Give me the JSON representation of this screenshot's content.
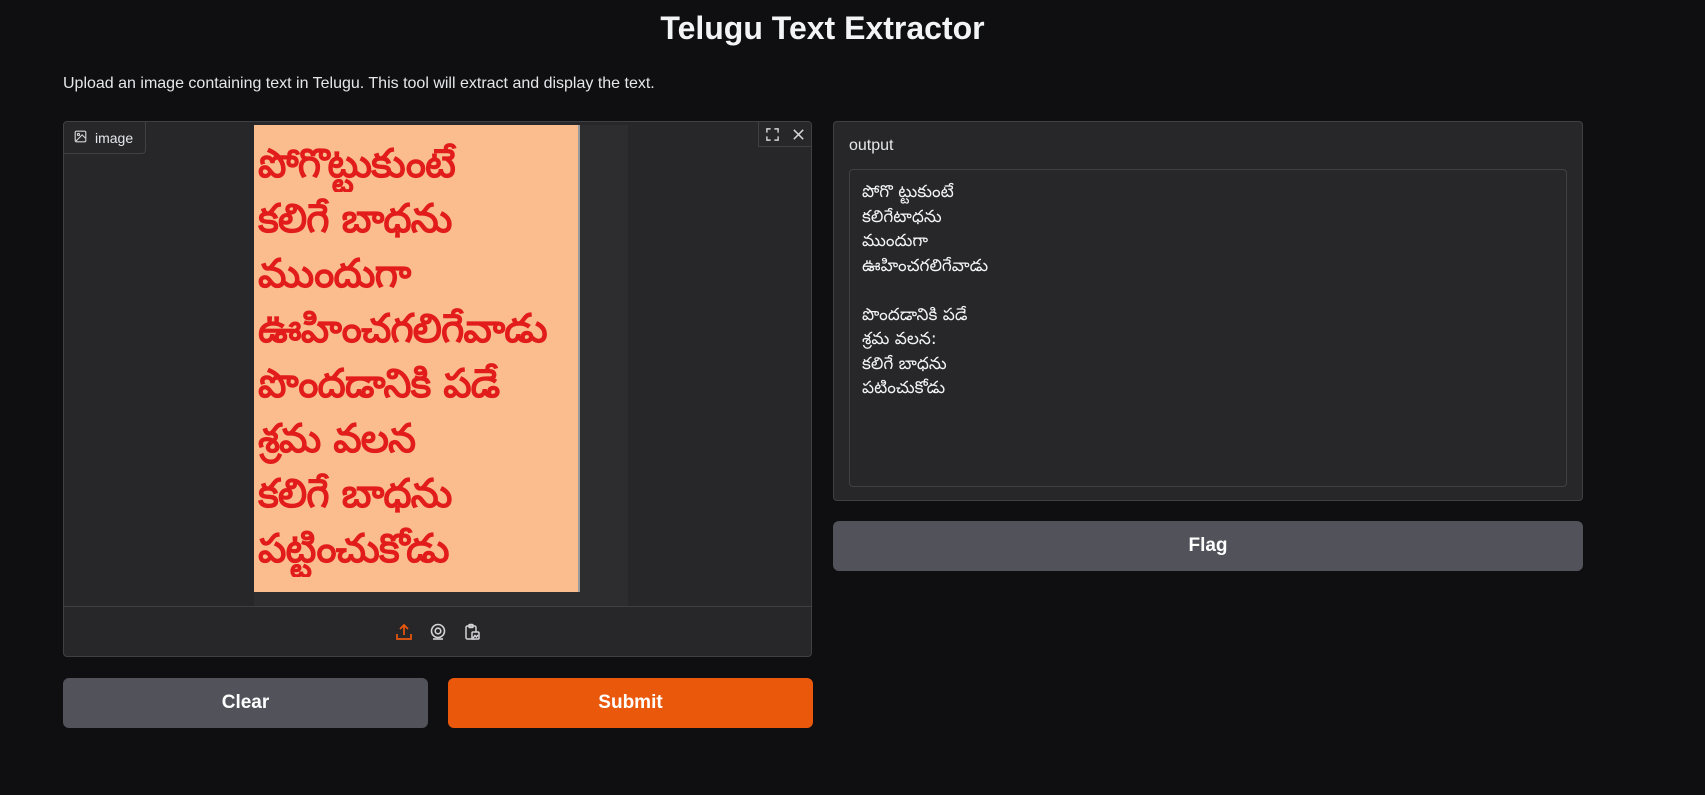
{
  "header": {
    "title": "Telugu Text Extractor",
    "description": "Upload an image containing text in Telugu. This tool will extract and display the text."
  },
  "image_input": {
    "label": "image",
    "icons": [
      "image-icon",
      "fullscreen-icon",
      "close-icon",
      "upload-icon",
      "webcam-icon",
      "clipboard-icon"
    ],
    "image_text_lines": [
      "పోగొట్టుకుంటే",
      "కలిగే బాధను",
      "ముందుగా",
      "ఊహించగలిగేవాడు",
      "పొందడానికి పడే",
      "శ్రమ వలన",
      "కలిగే బాధను",
      "పట్టించుకోడు"
    ]
  },
  "output": {
    "label": "output",
    "text": "పోగొ ట్టుకుంటే\nకలిగేటాధను\nముందుగా\nఊహించగలిగేవాడు\n\nపొందడానికి పడే\nశ్రమ వలన:\nకలిగే బాధను\nపటించుకోడు"
  },
  "buttons": {
    "clear": "Clear",
    "submit": "Submit",
    "flag": "Flag"
  },
  "colors": {
    "background": "#0f0f11",
    "panel": "#27272a",
    "accent": "#ea580c",
    "secondary_button": "#52525b",
    "image_text": "#e21b1b",
    "image_bg": "#fbbd8e"
  }
}
